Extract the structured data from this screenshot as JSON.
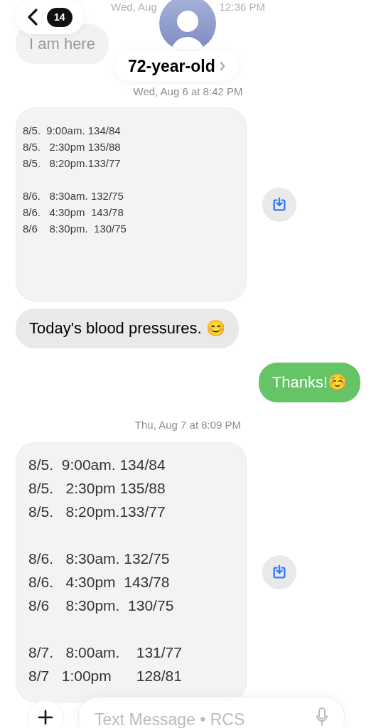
{
  "header": {
    "back_count": "14",
    "contact_name": "72-year-old"
  },
  "messages": [
    {
      "kind": "splitstamp",
      "parts": [
        "Wed, Aug",
        "12:36 PM"
      ]
    },
    {
      "kind": "incoming",
      "text": "I am here"
    },
    {
      "kind": "timestamp",
      "text": "Wed, Aug 6 at 8:42 PM"
    },
    {
      "kind": "thumbnail",
      "groups": [
        [
          "8/5.  9:00am. 134/84",
          "8/5.   2:30pm 135/88",
          "8/5.   8:20pm.133/77"
        ],
        [
          "8/6.   8:30am. 132/75",
          "8/6.   4:30pm  143/78",
          "8/6    8:30pm.  130/75"
        ]
      ]
    },
    {
      "kind": "incoming",
      "text": "Today's blood pressures. 😊"
    },
    {
      "kind": "outgoing",
      "text": "Thanks!☺️"
    },
    {
      "kind": "timestamp",
      "text": "Thu, Aug 7 at 8:09 PM"
    },
    {
      "kind": "attachment",
      "groups": [
        [
          "8/5.  9:00am. 134/84",
          "8/5.   2:30pm 135/88",
          "8/5.   8:20pm.133/77"
        ],
        [
          "8/6.   8:30am. 132/75",
          "8/6.   4:30pm  143/78",
          "8/6    8:30pm.  130/75"
        ],
        [
          "8/7.   8:00am.    131/77",
          "8/7   1:00pm      128/81"
        ]
      ]
    }
  ],
  "composer": {
    "placeholder": "Text Message • RCS"
  }
}
